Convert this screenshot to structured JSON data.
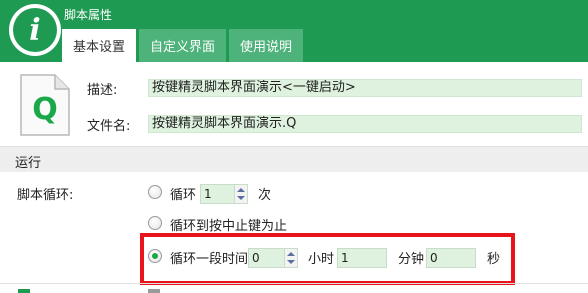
{
  "window": {
    "title": "脚本属性",
    "logo_glyph": "i"
  },
  "tabs": [
    {
      "label": "基本设置",
      "active": true
    },
    {
      "label": "自定义界面",
      "active": false
    },
    {
      "label": "使用说明",
      "active": false
    }
  ],
  "file": {
    "icon_glyph": "Q",
    "description_label": "描述:",
    "description_value": "按键精灵脚本界面演示<一键启动>",
    "filename_label": "文件名:",
    "filename_value": "按键精灵脚本界面演示.Q"
  },
  "run": {
    "section_title": "运行",
    "loop_label": "脚本循环:",
    "loop_count": {
      "label": "循环",
      "value": "1",
      "unit": "次",
      "checked": false
    },
    "loop_until_stop": {
      "label": "循环到按中止键为止",
      "checked": false
    },
    "loop_duration": {
      "label": "循环一段时间",
      "checked": true,
      "hours_value": "0",
      "hours_unit": "小时",
      "minutes_value": "1",
      "minutes_unit": "分钟",
      "seconds_value": "0",
      "seconds_unit": "秒"
    }
  },
  "colors": {
    "header": "#1f9a53",
    "field_bg": "#dff2df",
    "highlight": "#e8131b",
    "radio_dot": "#1aa84a"
  }
}
